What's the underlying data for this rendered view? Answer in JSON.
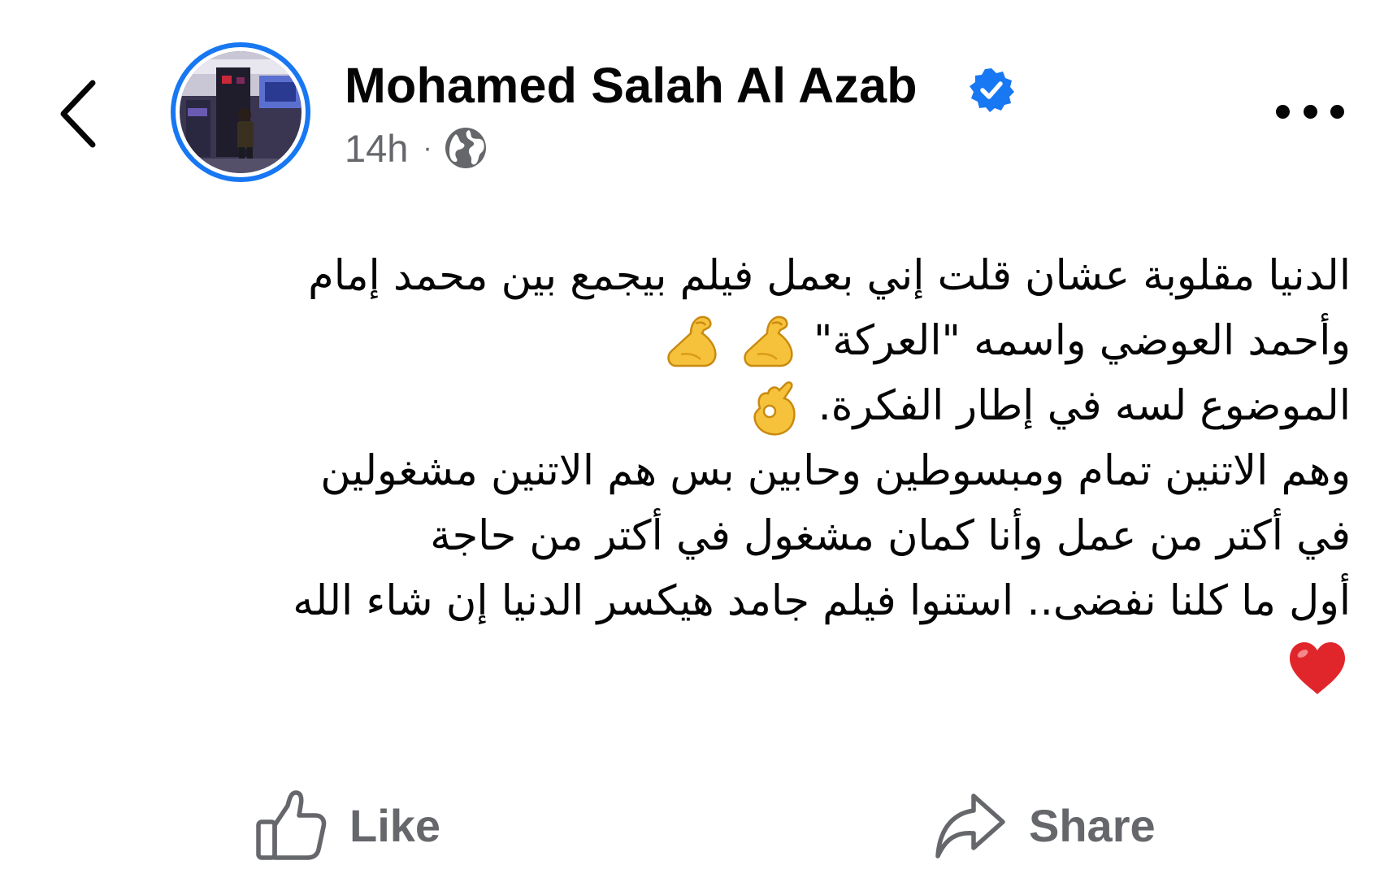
{
  "header": {
    "back_icon": "chevron-left-icon",
    "author_name": "Mohamed Salah Al Azab",
    "verified": true,
    "verified_color": "#1877f2",
    "timestamp": "14h",
    "separator": "·",
    "audience_icon": "globe-icon",
    "more_icon": "more-horizontal-icon"
  },
  "post": {
    "lines": [
      "الدنيا مقلوبة عشان قلت إني بعمل فيلم بيجمع بين محمد إمام",
      "وأحمد العوضي واسمه \"العركة\"",
      "الموضوع لسه في إطار الفكرة.",
      "وهم الاتنين تمام ومبسوطين وحابين بس هم الاتنين مشغولين",
      "في أكتر من عمل وأنا كمان مشغول في أكتر من حاجة",
      "أول ما كلنا نفضى.. استنوا فيلم جامد هيكسر الدنيا إن شاء الله"
    ],
    "emojis": [
      "flexed-biceps",
      "flexed-biceps",
      "ok-hand",
      "red-heart"
    ]
  },
  "actions": {
    "like_label": "Like",
    "like_icon": "thumbs-up-icon",
    "share_label": "Share",
    "share_icon": "share-arrow-icon",
    "label_color": "#65676b"
  }
}
